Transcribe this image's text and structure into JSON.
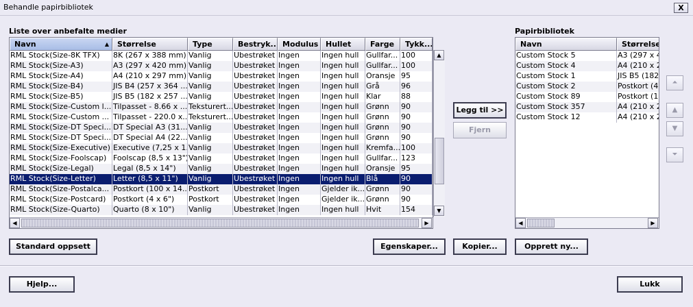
{
  "window": {
    "title": "Behandle papirbibliotek",
    "close_label": "X"
  },
  "left_list": {
    "label": "Liste over anbefalte medier",
    "columns": [
      "Navn",
      "Størrelse",
      "Type",
      "Bestryk...",
      "Modulus",
      "Hullet",
      "Farge",
      "Tykk..."
    ],
    "sort_indicator": "▲",
    "rows": [
      [
        "RML Stock(Size-8K TFX)",
        "8K (267 x 388 mm)",
        "Vanlig",
        "Ubestrøket",
        "Ingen",
        "Ingen hull",
        "Gullfar...",
        "100"
      ],
      [
        "RML Stock(Size-A3)",
        "A3 (297 x 420 mm)",
        "Vanlig",
        "Ubestrøket",
        "Ingen",
        "Ingen hull",
        "Gullfar...",
        "100"
      ],
      [
        "RML Stock(Size-A4)",
        "A4 (210 x 297 mm)",
        "Vanlig",
        "Ubestrøket",
        "Ingen",
        "Ingen hull",
        "Oransje",
        "95"
      ],
      [
        "RML Stock(Size-B4)",
        "JIS B4 (257 x 364 ...",
        "Vanlig",
        "Ubestrøket",
        "Ingen",
        "Ingen hull",
        "Grå",
        "96"
      ],
      [
        "RML Stock(Size-B5)",
        "JIS B5 (182 x 257 ...",
        "Vanlig",
        "Ubestrøket",
        "Ingen",
        "Ingen hull",
        "Klar",
        "88"
      ],
      [
        "RML Stock(Size-Custom l...",
        "Tilpasset - 8.66 x ...",
        "Teksturert...",
        "Ubestrøket",
        "Ingen",
        "Ingen hull",
        "Grønn",
        "90"
      ],
      [
        "RML Stock(Size-Custom ...",
        "Tilpasset - 220.0 x...",
        "Teksturert...",
        "Ubestrøket",
        "Ingen",
        "Ingen hull",
        "Grønn",
        "90"
      ],
      [
        "RML Stock(Size-DT Speci...",
        "DT Special A3 (31...",
        "Vanlig",
        "Ubestrøket",
        "Ingen",
        "Ingen hull",
        "Grønn",
        "90"
      ],
      [
        "RML Stock(Size-DT Speci...",
        "DT Special A4 (22...",
        "Vanlig",
        "Ubestrøket",
        "Ingen",
        "Ingen hull",
        "Grønn",
        "90"
      ],
      [
        "RML Stock(Size-Executive)",
        "Executive (7,25 x 1...",
        "Vanlig",
        "Ubestrøket",
        "Ingen",
        "Ingen hull",
        "Kremfa...",
        "100"
      ],
      [
        "RML Stock(Size-Foolscap)",
        "Foolscap (8,5 x 13\")",
        "Vanlig",
        "Ubestrøket",
        "Ingen",
        "Ingen hull",
        "Gullfar...",
        "123"
      ],
      [
        "RML Stock(Size-Legal)",
        "Legal (8,5 x 14\")",
        "Vanlig",
        "Ubestrøket",
        "Ingen",
        "Ingen hull",
        "Oransje",
        "95"
      ],
      [
        "RML Stock(Size-Letter)",
        "Letter (8,5 x 11\")",
        "Vanlig",
        "Ubestrøket",
        "Ingen",
        "Ingen hull",
        "Blå",
        "90"
      ],
      [
        "RML Stock(Size-Postalca...",
        "Postkort (100 x 14...",
        "Postkort",
        "Ubestrøket",
        "Ingen",
        "Gjelder ik...",
        "Grønn",
        "90"
      ],
      [
        "RML Stock(Size-Postcard)",
        "Postkort (4 x 6\")",
        "Postkort",
        "Ubestrøket",
        "Ingen",
        "Gjelder ik...",
        "Grønn",
        "90"
      ],
      [
        "RML Stock(Size-Quarto)",
        "Quarto (8 x 10\")",
        "Vanlig",
        "Ubestrøket",
        "Ingen",
        "Ingen hull",
        "Hvit",
        "154"
      ]
    ],
    "selected_row": 12
  },
  "middle": {
    "add_label": "Legg til >>",
    "remove_label": "Fjern"
  },
  "right_list": {
    "label": "Papirbibliotek",
    "columns": [
      "Navn",
      "Størrelse"
    ],
    "rows": [
      [
        "Custom Stock 5",
        "A3 (297 x 4"
      ],
      [
        "Custom Stock 4",
        "A4 (210 x 2"
      ],
      [
        "Custom Stock 1",
        "JIS B5 (182"
      ],
      [
        "Custom Stock 2",
        "Postkort (4"
      ],
      [
        "Custom Stock 89",
        "Postkort (1"
      ],
      [
        "Custom Stock 357",
        "A4 (210 x 2"
      ],
      [
        "Custom Stock 12",
        "A4 (210 x 2"
      ]
    ]
  },
  "buttons": {
    "standard": "Standard oppsett",
    "properties": "Egenskaper...",
    "copy": "Kopier...",
    "create": "Opprett ny...",
    "help": "Hjelp...",
    "close": "Lukk"
  },
  "colors": {
    "selection": "#0a1d6f",
    "background": "#ebeaf4"
  }
}
